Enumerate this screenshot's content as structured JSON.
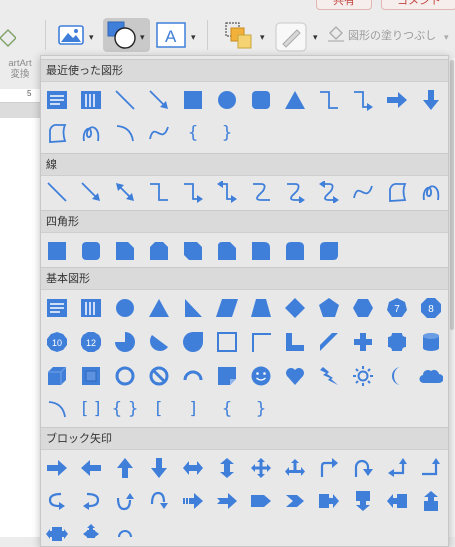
{
  "toolbar": {
    "share_label": "共有",
    "comment_label": "コメント",
    "fill_label": "図形の塗りつぶし",
    "chevron": "▾"
  },
  "left_panel": {
    "smartart_line1": "artArt",
    "smartart_line2": "変換",
    "ruler_number": "5"
  },
  "sections": {
    "recent": {
      "title": "最近使った図形"
    },
    "lines": {
      "title": "線"
    },
    "rect": {
      "title": "四角形"
    },
    "basic": {
      "title": "基本図形"
    },
    "block": {
      "title": "ブロック矢印"
    }
  },
  "glyphs": {
    "brace_open": "{",
    "brace_close": "}",
    "bracket_pair": "[ ]",
    "brace_pair": "{ }",
    "bracket_open": "[",
    "bracket_close": "]",
    "num10": "10",
    "num12": "12",
    "num7": "7",
    "num8": "8"
  },
  "colors": {
    "accent": "#3f7fda",
    "panel_bg": "#e8e8e8",
    "header_bg": "#dadada",
    "share": "#c2463e"
  }
}
